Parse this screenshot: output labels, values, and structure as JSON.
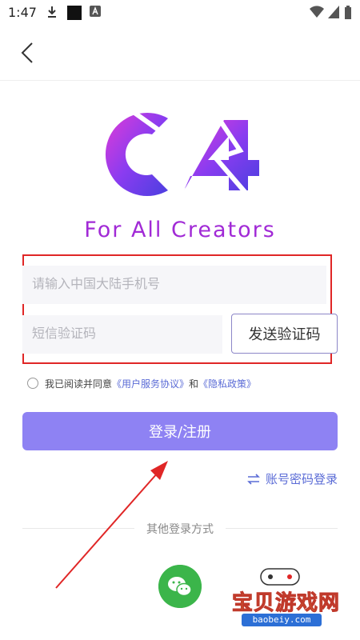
{
  "status_bar": {
    "time": "1:47"
  },
  "brand": {
    "logo_text": "C4",
    "tagline": "For All Creators",
    "accent_color": "#a12ad6"
  },
  "form": {
    "phone_placeholder": "请输入中国大陆手机号",
    "code_placeholder": "短信验证码",
    "send_code_label": "发送验证码"
  },
  "agreement": {
    "prefix": "我已阅读并同意",
    "user_agreement": "《用户服务协议》",
    "and": "和",
    "privacy_policy": "《隐私政策》"
  },
  "login_button_label": "登录/注册",
  "login_button_color": "#8e82f3",
  "account_login_label": "账号密码登录",
  "other_methods_label": "其他登录方式",
  "watermark": {
    "title": "宝贝游戏网",
    "url": "baobeiy.com"
  }
}
